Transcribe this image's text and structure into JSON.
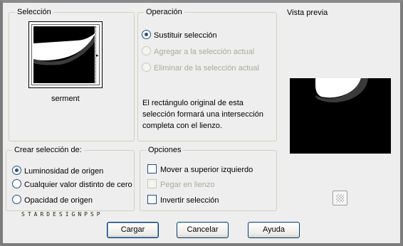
{
  "seleccion": {
    "title": "Selección",
    "thumb_label": "serment",
    "arrow": "▸"
  },
  "operacion": {
    "title": "Operación",
    "options": [
      {
        "label": "Sustituir selección",
        "checked": true,
        "enabled": true
      },
      {
        "label": "Agregar a la selección actual",
        "checked": false,
        "enabled": false
      },
      {
        "label": "Eliminar de la selección actual",
        "checked": false,
        "enabled": false
      }
    ],
    "description": "El rectángulo original de esta selección formará una intersección completa con el lienzo."
  },
  "vista_previa": {
    "title": "Vista previa",
    "icon": "checkerboard-icon"
  },
  "crear": {
    "title": "Crear selección de:",
    "options": [
      {
        "label": "Luminosidad de origen",
        "checked": true
      },
      {
        "label": "Cualquier valor distinto de cero",
        "checked": false
      },
      {
        "label": "Opacidad de origen",
        "checked": false
      }
    ]
  },
  "opciones": {
    "title": "Opciones",
    "items": [
      {
        "label": "Mover a superior izquierdo",
        "checked": false,
        "enabled": true
      },
      {
        "label": "Pegar en lienzo",
        "checked": false,
        "enabled": false
      },
      {
        "label": "Invertir selección",
        "checked": false,
        "enabled": true
      }
    ]
  },
  "watermark": "STARDESIGNPSP",
  "buttons": {
    "load": "Cargar",
    "cancel": "Cancelar",
    "help": "Ayuda"
  }
}
